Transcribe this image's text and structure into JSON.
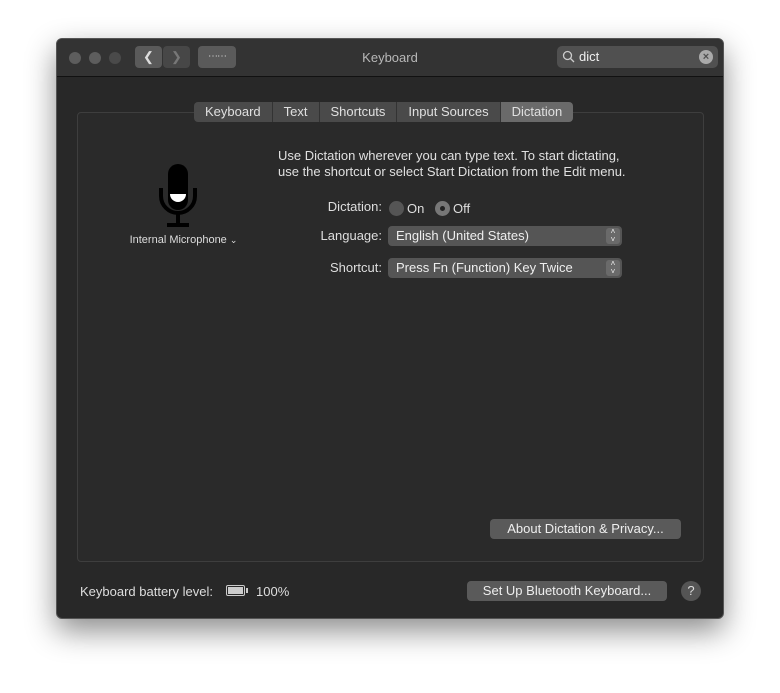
{
  "window": {
    "title": "Keyboard"
  },
  "search": {
    "value": "dict"
  },
  "tabs": [
    {
      "label": "Keyboard"
    },
    {
      "label": "Text"
    },
    {
      "label": "Shortcuts"
    },
    {
      "label": "Input Sources"
    },
    {
      "label": "Dictation",
      "selected": true
    }
  ],
  "dictation": {
    "description_line1": "Use Dictation wherever you can type text. To start dictating,",
    "description_line2": "use the shortcut or select Start Dictation from the Edit menu.",
    "microphone": "Internal Microphone",
    "dictation_label": "Dictation:",
    "on_label": "On",
    "off_label": "Off",
    "selected": "Off",
    "language_label": "Language:",
    "language_value": "English (United States)",
    "shortcut_label": "Shortcut:",
    "shortcut_value": "Press Fn (Function) Key Twice",
    "about_button": "About Dictation & Privacy..."
  },
  "footer": {
    "battery_label": "Keyboard battery level:",
    "battery_value": "100%",
    "battery_level": 1.0,
    "bluetooth_button": "Set Up Bluetooth Keyboard...",
    "help": "?"
  }
}
